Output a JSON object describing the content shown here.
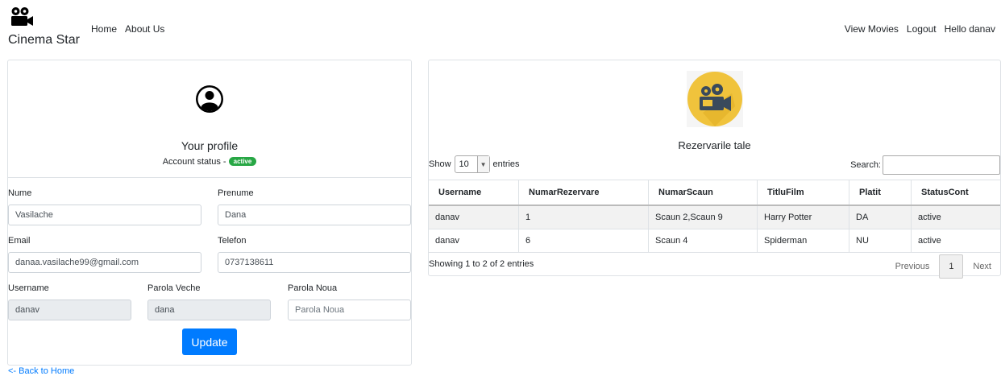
{
  "navbar": {
    "brand": "Cinema Star",
    "brand_icon": "movie-camera-icon",
    "left_links": [
      "Home",
      "About Us"
    ],
    "right_links": [
      "View Movies",
      "Logout",
      "Hello danav"
    ]
  },
  "profile": {
    "avatar_icon": "user-circle-icon",
    "title": "Your profile",
    "status_label": "Account status -",
    "status_badge": "active",
    "badge_color": "#28a745",
    "fields": {
      "nume": {
        "label": "Nume",
        "value": "Vasilache"
      },
      "prenume": {
        "label": "Prenume",
        "value": "Dana"
      },
      "email": {
        "label": "Email",
        "value": "danaa.vasilache99@gmail.com"
      },
      "telefon": {
        "label": "Telefon",
        "value": "0737138611"
      },
      "username": {
        "label": "Username",
        "value": "danav"
      },
      "parola_veche": {
        "label": "Parola Veche",
        "value": "dana"
      },
      "parola_noua": {
        "label": "Parola Noua",
        "value": "",
        "placeholder": "Parola Noua"
      }
    },
    "update_label": "Update",
    "primary_color": "#007bff"
  },
  "back_link": "<- Back to Home",
  "reservations": {
    "icon": "film-projector-icon",
    "title": "Rezervarile tale",
    "show_label": "Show",
    "entries_value": "10",
    "entries_label": "entries",
    "search_label": "Search:",
    "columns": [
      "Username",
      "NumarRezervare",
      "NumarScaun",
      "TitluFilm",
      "Platit",
      "StatusCont"
    ],
    "rows": [
      [
        "danav",
        "1",
        "Scaun 2,Scaun 9",
        "Harry Potter",
        "DA",
        "active"
      ],
      [
        "danav",
        "6",
        "Scaun 4",
        "Spiderman",
        "NU",
        "active"
      ]
    ],
    "info": "Showing 1 to 2 of 2 entries",
    "pagination": {
      "previous": "Previous",
      "page": "1",
      "next": "Next"
    }
  }
}
